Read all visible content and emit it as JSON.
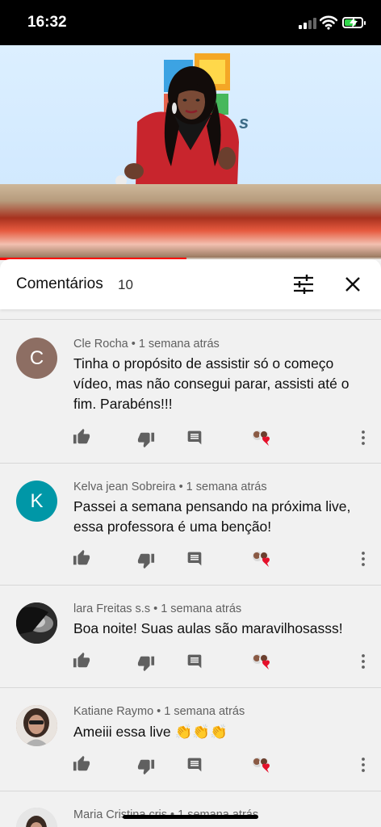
{
  "status_bar": {
    "time": "16:32",
    "battery_level": 0.72
  },
  "video": {
    "progress": 0.49
  },
  "comments_panel": {
    "title": "Comentários",
    "count": "10"
  },
  "comments": [
    {
      "author": "Cle Rocha",
      "time": "1 semana atrás",
      "meta": "Cle Rocha • 1 semana atrás",
      "text": "Tinha o propósito de assistir só o começo vídeo, mas não consegui parar, assisti até o fim. Parabéns!!!",
      "avatar_letter": "C",
      "avatar_color": "#8d6e63"
    },
    {
      "author": "Kelva jean Sobreira",
      "time": "1 semana atrás",
      "meta": "Kelva jean Sobreira • 1 semana atrás",
      "text": "Passei a semana pensando na próxima live, essa professora é uma benção!",
      "avatar_letter": "K",
      "avatar_color": "#0097a7"
    },
    {
      "author": "lara Freitas s.s",
      "time": "1 semana atrás",
      "meta": "lara Freitas s.s • 1 semana atrás",
      "text": "Boa noite! Suas aulas são maravilhosasss!",
      "avatar_letter": "",
      "avatar_color": "#2b2b2b"
    },
    {
      "author": "Katiane Raymo",
      "time": "1 semana atrás",
      "meta": "Katiane Raymo • 1 semana atrás",
      "text": "Ameiii essa live 👏👏👏",
      "avatar_letter": "",
      "avatar_color": "#b98a77"
    },
    {
      "author": "Maria Cristina cris",
      "time": "1 semana atrás",
      "meta": "Maria Cristina cris • 1 semana atrás",
      "text": "",
      "avatar_letter": "",
      "avatar_color": "#cfcfcf"
    }
  ],
  "icons": {
    "like": "thumb-up-icon",
    "dislike": "thumb-down-icon",
    "reply": "reply-comment-icon",
    "creator_heart": "creator-heart-icon",
    "more": "more-vertical-icon"
  },
  "colors": {
    "accent": "#ff0000",
    "heart": "#e5102a"
  }
}
